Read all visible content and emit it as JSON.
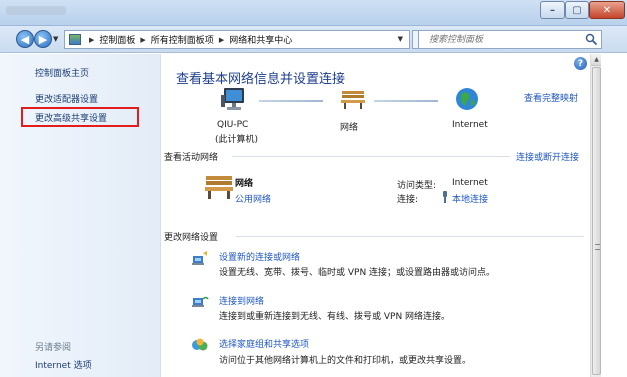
{
  "titlebar": {
    "buttons": {
      "minimize": "–",
      "maximize": "▢",
      "close": "✕"
    }
  },
  "address_bar": {
    "back_label": "◀",
    "forward_label": "▶",
    "crumbs": [
      "控制面板",
      "所有控制面板项",
      "网络和共享中心"
    ],
    "refresh_label": "↻",
    "search_placeholder": "搜索控制面板"
  },
  "sidebar": {
    "home": "控制面板主页",
    "adapter_settings": "更改适配器设置",
    "advanced_sharing": "更改高级共享设置",
    "see_also": "另请参阅",
    "internet_options": "Internet 选项"
  },
  "main": {
    "help_label": "?",
    "heading": "查看基本网络信息并设置连接",
    "full_map_link": "查看完整映射",
    "map": {
      "pc_name": "QIU-PC",
      "pc_sub": "(此计算机)",
      "network_label": "网络",
      "internet_label": "Internet"
    },
    "active_networks": {
      "section_title": "查看活动网络",
      "disconnect_link": "连接或断开连接",
      "network_name": "网络",
      "network_type": "公用网络",
      "access_type_label": "访问类型:",
      "access_type_value": "Internet",
      "connections_label": "连接:",
      "connections_value": "本地连接"
    },
    "change_settings": {
      "section_title": "更改网络设置",
      "tasks": [
        {
          "title": "设置新的连接或网络",
          "desc": "设置无线、宽带、拨号、临时或 VPN 连接；或设置路由器或访问点。"
        },
        {
          "title": "连接到网络",
          "desc": "连接到或重新连接到无线、有线、拨号或 VPN 网络连接。"
        },
        {
          "title": "选择家庭组和共享选项",
          "desc": "访问位于其他网络计算机上的文件和打印机，或更改共享设置。"
        }
      ]
    }
  },
  "colors": {
    "link": "#1f57c3",
    "heading": "#1e3f8c",
    "highlight_box": "#e31d1d",
    "sidebar_bg": "#e3ecf7"
  },
  "icons": {
    "pc": "computer-monitor-icon",
    "network": "park-bench-icon",
    "internet": "globe-icon",
    "connection": "network-plug-icon",
    "task1": "network-setup-icon",
    "task2": "connect-network-icon",
    "task3": "homegroup-icon",
    "search": "magnifier-icon"
  }
}
